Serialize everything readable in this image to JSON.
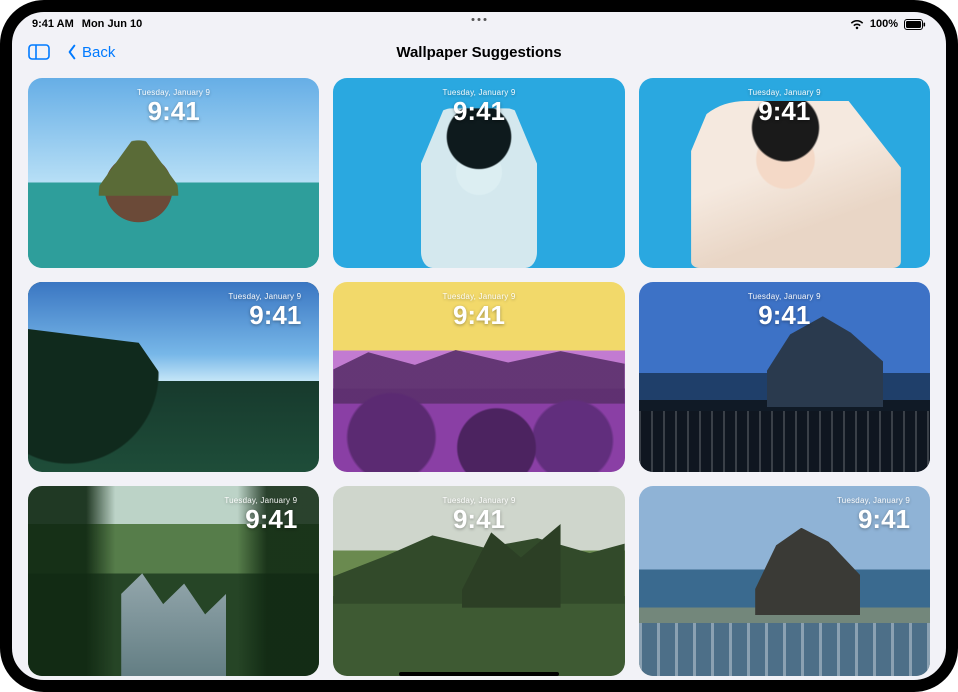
{
  "status": {
    "time": "9:41 AM",
    "date": "Mon Jun 10",
    "battery_pct": "100%"
  },
  "nav": {
    "back_label": "Back",
    "title": "Wallpaper Suggestions"
  },
  "tile_overlay": {
    "date": "Tuesday, January 9",
    "time": "9:41"
  },
  "tiles": [
    {
      "id": "volcano-lagoon",
      "overlay_align": "center"
    },
    {
      "id": "portrait-duotone",
      "overlay_align": "center"
    },
    {
      "id": "portrait-selfie",
      "overlay_align": "center"
    },
    {
      "id": "coastal-cliff",
      "overlay_align": "right"
    },
    {
      "id": "beach-duotone",
      "overlay_align": "center"
    },
    {
      "id": "black-sand-rock",
      "overlay_align": "center"
    },
    {
      "id": "jungle-stream",
      "overlay_align": "right"
    },
    {
      "id": "highland-plateau",
      "overlay_align": "center"
    },
    {
      "id": "sea-stack",
      "overlay_align": "right"
    }
  ]
}
